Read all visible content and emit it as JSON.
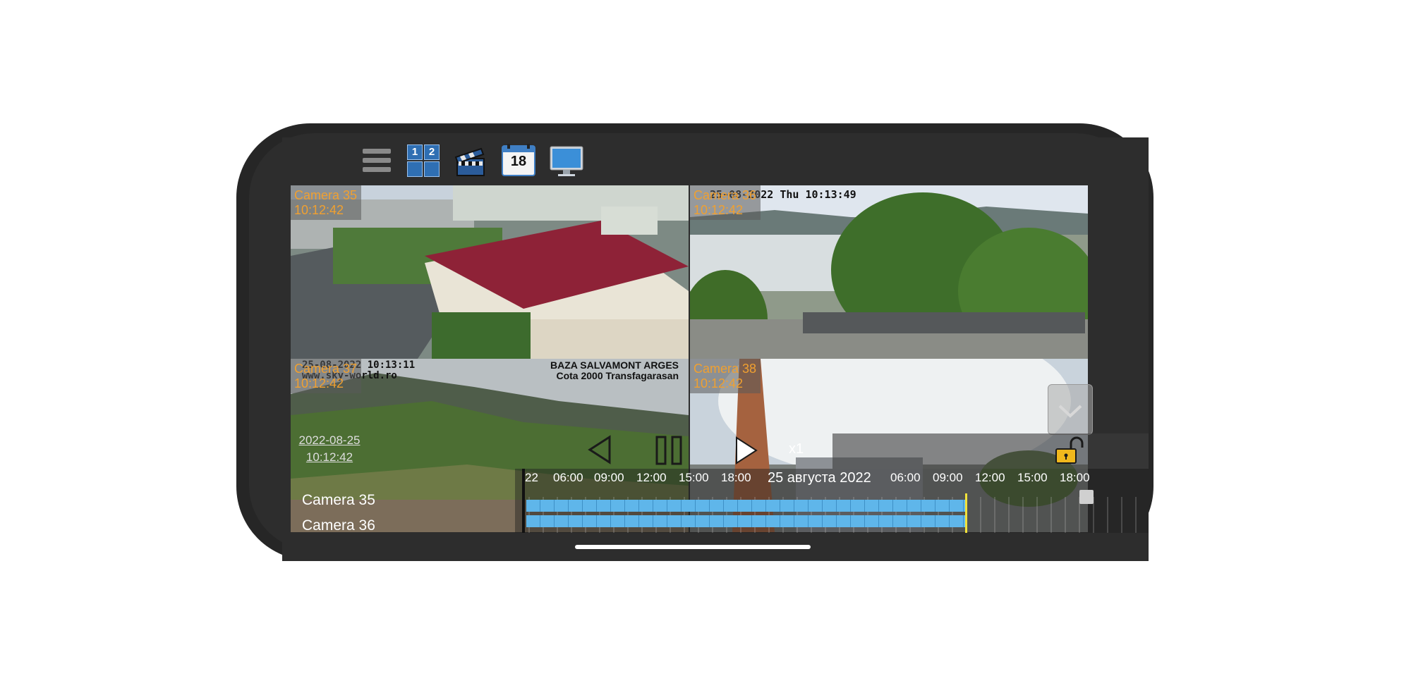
{
  "toolbar": {
    "grid_numbers": [
      "1",
      "2"
    ],
    "calendar_day": "18",
    "icons": [
      "menu-icon",
      "layout-grid-icon",
      "clapperboard-icon",
      "calendar-icon",
      "monitor-icon"
    ]
  },
  "cameras": [
    {
      "name": "Camera 35",
      "time": "10:12:42"
    },
    {
      "name": "Camera 36",
      "time": "10:12:42",
      "osd": "25-08-2022 Thu 10:13:49"
    },
    {
      "name": "Camera 37",
      "time": "10:12:42",
      "osd_left_1": "25-08-2022 10:13:11",
      "osd_left_2": "www.sky-world.ro",
      "osd_right_1": "BAZA SALVAMONT ARGES",
      "osd_right_2": "Cota 2000 Transfagarasan"
    },
    {
      "name": "Camera 38",
      "time": "10:12:42"
    }
  ],
  "playback": {
    "date": "2022-08-25",
    "time": "10:12:42",
    "speed": "x1"
  },
  "timeline": {
    "ticks_left": [
      "22",
      "06:00",
      "09:00",
      "12:00",
      "15:00",
      "18:00"
    ],
    "date_label": "25 августа 2022",
    "ticks_right": [
      "06:00",
      "09:00",
      "12:00",
      "15:00",
      "18:00"
    ],
    "rows": [
      "Camera 35",
      "Camera 36"
    ]
  },
  "colors": {
    "label_orange": "#f0a030",
    "bar_blue": "#5fb6ea",
    "cursor_yellow": "#f2e23a",
    "lock_yellow": "#f1b81d"
  }
}
